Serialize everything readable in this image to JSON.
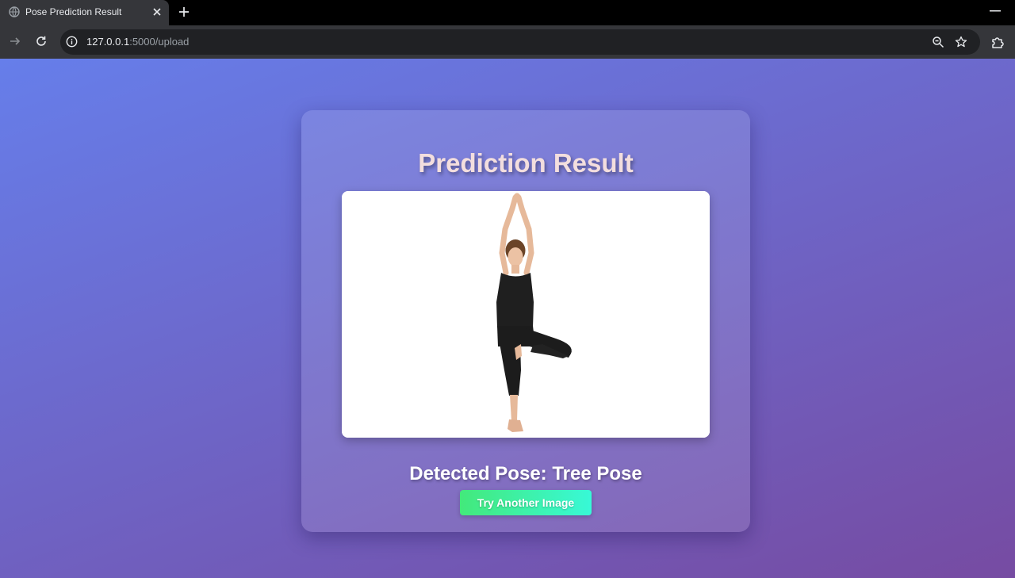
{
  "browser": {
    "tab_title": "Pose Prediction Result",
    "url_host": "127.0.0.1",
    "url_path": ":5000/upload",
    "icons": [
      "globe-icon",
      "close-icon",
      "plus-icon",
      "minimize-icon",
      "forward-icon",
      "reload-icon",
      "info-icon",
      "zoom-icon",
      "star-icon",
      "extensions-icon"
    ]
  },
  "page": {
    "title": "Prediction Result",
    "detected_label": "Detected Pose: Tree Pose",
    "button_label": "Try Another Image"
  },
  "colors": {
    "background_start": "#667eea",
    "background_end": "#764ba2",
    "button_start": "#43e97b",
    "button_end": "#38f9d7"
  }
}
